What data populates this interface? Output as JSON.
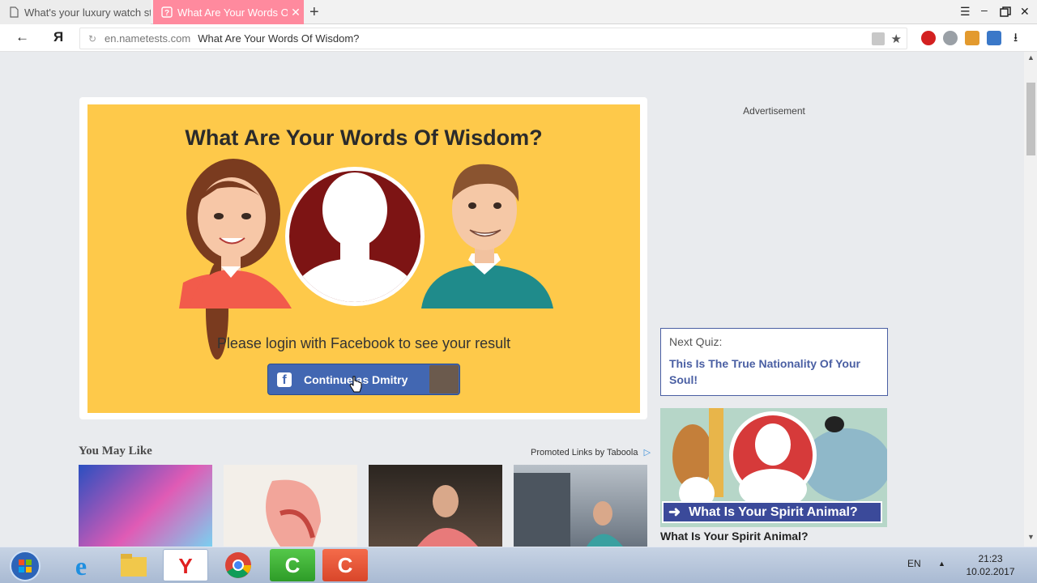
{
  "browser": {
    "tabs": [
      {
        "title": "What's your luxury watch sty",
        "active": false
      },
      {
        "title": "What Are Your Words Of",
        "active": true
      }
    ],
    "new_tab_icon": "plus-icon",
    "address": {
      "host": "en.nametests.com",
      "page_title": "What Are Your Words Of Wisdom?"
    }
  },
  "page": {
    "quiz_title": "What Are Your Words Of Wisdom?",
    "login_prompt": "Please login with Facebook to see your result",
    "fb_button_label": "Continue as Dmitry",
    "advertisement_label": "Advertisement",
    "next_quiz": {
      "label": "Next Quiz:",
      "title": "This Is The True Nationality Of Your Soul!"
    },
    "spirit_promo": {
      "banner_text": "What Is Your Spirit Animal?",
      "caption": "What Is Your Spirit Animal?"
    },
    "you_may_like": {
      "heading": "You May Like",
      "promoted": "Promoted Links by Taboola"
    }
  },
  "taskbar": {
    "language": "EN",
    "time": "21:23",
    "date": "10.02.2017"
  },
  "colors": {
    "banner": "#fec94a",
    "facebook": "#4267b2",
    "active_tab": "#ff8a9e",
    "link": "#4a5fa3"
  }
}
